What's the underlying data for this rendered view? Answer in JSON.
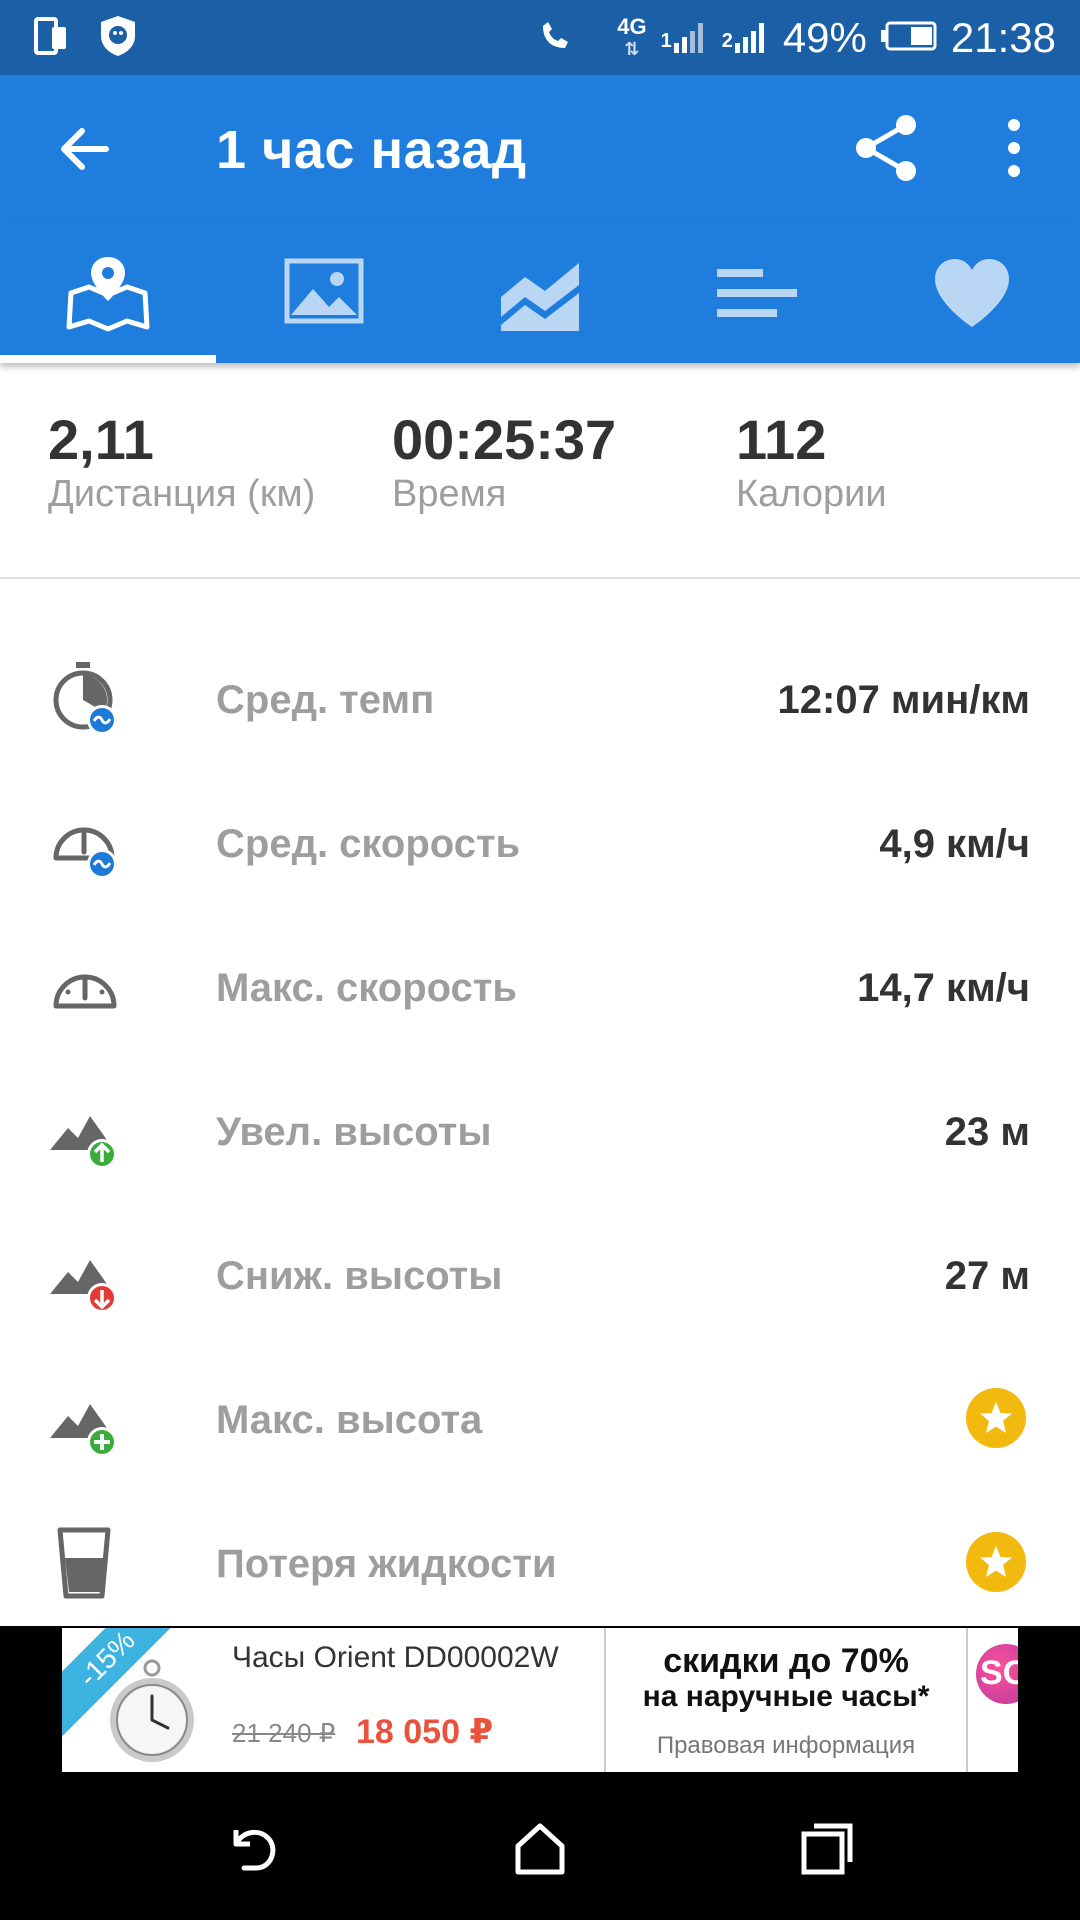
{
  "status_bar": {
    "network_label": "4G",
    "sim1_label": "1",
    "sim2_label": "2",
    "battery": "49%",
    "time": "21:38"
  },
  "app_bar": {
    "title": "1 час назад",
    "back_icon": "arrow-left-icon",
    "share_icon": "share-icon",
    "more_icon": "more-vert-icon"
  },
  "tabs": [
    {
      "icon": "map-pin-icon",
      "selected": true
    },
    {
      "icon": "image-icon",
      "selected": false
    },
    {
      "icon": "area-chart-icon",
      "selected": false
    },
    {
      "icon": "bars-icon",
      "selected": false
    },
    {
      "icon": "heart-icon",
      "selected": false
    }
  ],
  "summary": {
    "distance_value": "2,11",
    "distance_label": "Дистанция (км)",
    "time_value": "00:25:37",
    "time_label": "Время",
    "calories_value": "112",
    "calories_label": "Калории"
  },
  "stats": [
    {
      "label": "Сред. темп",
      "value": "12:07 мин/км",
      "icon": "stopwatch-avg-icon"
    },
    {
      "label": "Сред. скорость",
      "value": "4,9 км/ч",
      "icon": "speedometer-avg-icon"
    },
    {
      "label": "Макс. скорость",
      "value": "14,7 км/ч",
      "icon": "speedometer-icon"
    },
    {
      "label": "Увел. высоты",
      "value": "23 м",
      "icon": "elevation-gain-icon"
    },
    {
      "label": "Сниж. высоты",
      "value": "27 м",
      "icon": "elevation-loss-icon"
    },
    {
      "label": "Макс. высота",
      "value": "",
      "icon": "elevation-max-icon",
      "premium": true
    },
    {
      "label": "Потеря жидкости",
      "value": "",
      "icon": "glass-icon",
      "premium": true
    }
  ],
  "ad": {
    "discount": "-15%",
    "product_name": "Часы Orient DD00002W",
    "old_price": "21 240 ₽",
    "new_price": "18 050 ₽",
    "promo_line1": "скидки до 70%",
    "promo_line2": "на наручные часы*",
    "legal": "Правовая информация",
    "logo_text": "SO"
  },
  "nav_bar": {
    "back_icon": "nav-back-icon",
    "home_icon": "nav-home-icon",
    "recents_icon": "nav-recents-icon"
  },
  "colors": {
    "status_bar": "#1b5fa6",
    "app_bar": "#1f7ddd",
    "premium_star": "#f2b90f",
    "gain_green": "#3bab3b",
    "loss_red": "#e53935",
    "avg_blue": "#1e78d6",
    "price_red": "#e9533d"
  }
}
